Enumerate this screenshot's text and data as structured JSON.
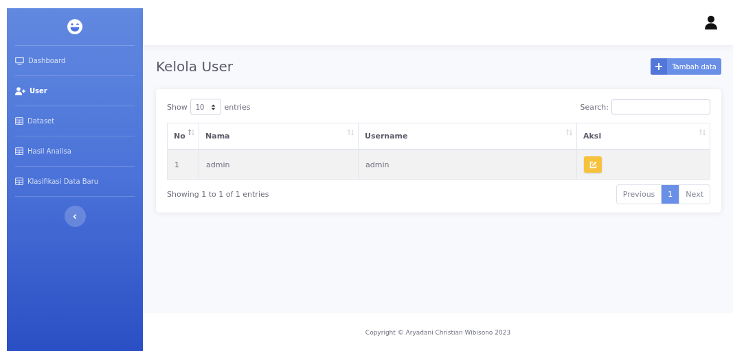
{
  "sidebar": {
    "items": [
      {
        "label": "Dashboard",
        "kind": "monitor",
        "selected": false
      },
      {
        "label": "User",
        "kind": "user",
        "selected": true
      },
      {
        "label": "Dataset",
        "kind": "table",
        "selected": false
      },
      {
        "label": "Hasil Analisa",
        "kind": "table",
        "selected": false
      },
      {
        "label": "Klasifikasi Data Baru",
        "kind": "table",
        "selected": false
      }
    ]
  },
  "page_title": "Kelola User",
  "add_button": "Tambah data",
  "table_controls": {
    "show_label": "Show",
    "page_size": "10",
    "entries_label": "entries",
    "search_label": "Search:"
  },
  "table": {
    "columns": [
      {
        "label": "No",
        "sorted": true
      },
      {
        "label": "Nama",
        "sorted": false
      },
      {
        "label": "Username",
        "sorted": false
      },
      {
        "label": "Aksi",
        "sorted": false
      }
    ],
    "rows": [
      {
        "no": "1",
        "nama": "admin",
        "username": "admin"
      }
    ]
  },
  "info": "Showing 1 to 1 of 1 entries",
  "pagination": [
    {
      "label": "Previous",
      "selected": false
    },
    {
      "label": "1",
      "selected": true
    },
    {
      "label": "Next",
      "selected": false
    }
  ],
  "footer": "Copyright © Aryadani Christian Wibisono 2023"
}
